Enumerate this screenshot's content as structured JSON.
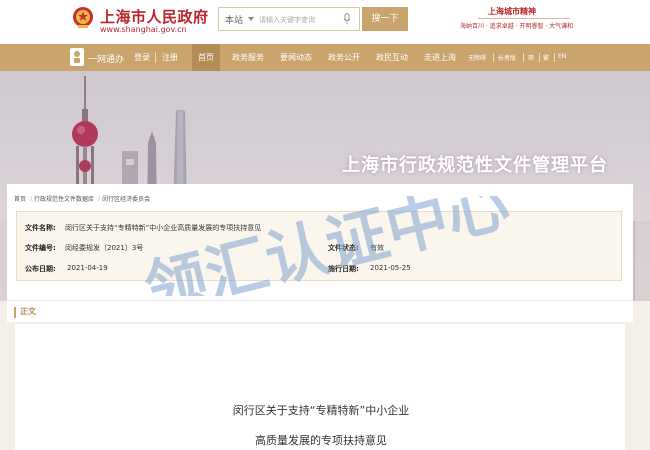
{
  "header": {
    "site_title": "上海市人民政府",
    "site_url": "www.shanghai.gov.cn",
    "search": {
      "scope": "本站",
      "placeholder": "请输入关键字查询",
      "button": "搜一下"
    },
    "spirit": {
      "title": "上海城市精神",
      "text": "海纳百川 · 追求卓越 · 开明睿智 · 大气谦和"
    }
  },
  "nav": {
    "logo_text": "一网通办",
    "login": "登录",
    "register": "注册",
    "items": [
      {
        "label": "首页",
        "active": true
      },
      {
        "label": "政务服务",
        "active": false
      },
      {
        "label": "要闻动态",
        "active": false
      },
      {
        "label": "政务公开",
        "active": false
      },
      {
        "label": "政民互动",
        "active": false
      },
      {
        "label": "走进上海",
        "active": false
      }
    ],
    "utils": [
      "无障碍",
      "长者版",
      "简",
      "繁",
      "EN"
    ]
  },
  "banner": {
    "title": "上海市行政规范性文件管理平台"
  },
  "breadcrumb": [
    "首页",
    "行政规范性文件数据库",
    "闵行区经济委员会"
  ],
  "document": {
    "name_label": "文件名称:",
    "name_value": "闵行区关于支持“专精特新”中小企业高质量发展的专项扶持意见",
    "number_label": "文件编号:",
    "number_value": "闵经委规发〔2021〕3号",
    "status_label": "文件状态:",
    "status_value": "有效",
    "publish_label": "公布日期:",
    "publish_value": "2021-04-19",
    "effective_label": "施行日期:",
    "effective_value": "2021-05-25"
  },
  "body": {
    "section_label": "正文",
    "title_line1": "闵行区关于支持“专精特新”中小企业",
    "title_line2": "高质量发展的专项扶持意见"
  },
  "watermark": "领汇认证中心",
  "colors": {
    "brand_red": "#b8272c",
    "gold": "#c9a46c",
    "gold_dark": "#b38c56"
  }
}
